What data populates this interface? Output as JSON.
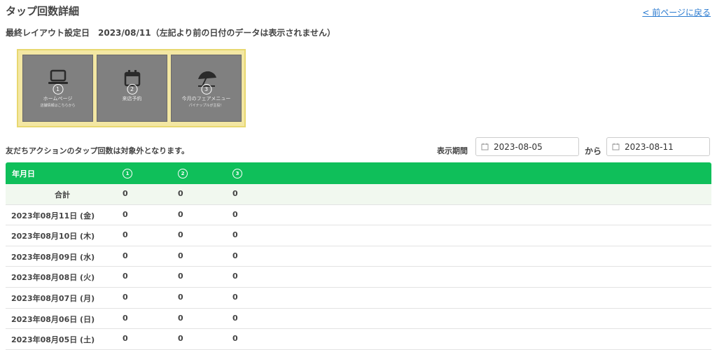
{
  "header": {
    "title": "タップ回数詳細",
    "back_link": "< 前ページに戻る",
    "layout_date": "最終レイアウト設定日　2023/08/11（左記より前の日付のデータは表示されません）"
  },
  "rich_menu": {
    "tiles": [
      {
        "number": "1",
        "label": "ホームページ",
        "sub": "店舗情報はこちらから",
        "icon": "laptop-icon"
      },
      {
        "number": "2",
        "label": "来店予約",
        "sub": "",
        "icon": "calendar-icon"
      },
      {
        "number": "3",
        "label": "今月のフェアメニュー",
        "sub": "パイナップルが主役！",
        "icon": "beach-umbrella-icon"
      }
    ]
  },
  "filter": {
    "note": "友だちアクションのタップ回数は対象外となります。",
    "period_label": "表示期間",
    "from": "2023-08-05",
    "separator": "から",
    "to": "2023-08-11"
  },
  "table": {
    "header": {
      "date": "年月日",
      "cols": [
        "1",
        "2",
        "3"
      ]
    },
    "total": {
      "label": "合計",
      "values": [
        "0",
        "0",
        "0"
      ]
    },
    "rows": [
      {
        "date": "2023年08月11日 (金)",
        "values": [
          "0",
          "0",
          "0"
        ]
      },
      {
        "date": "2023年08月10日 (木)",
        "values": [
          "0",
          "0",
          "0"
        ]
      },
      {
        "date": "2023年08月09日 (水)",
        "values": [
          "0",
          "0",
          "0"
        ]
      },
      {
        "date": "2023年08月08日 (火)",
        "values": [
          "0",
          "0",
          "0"
        ]
      },
      {
        "date": "2023年08月07日 (月)",
        "values": [
          "0",
          "0",
          "0"
        ]
      },
      {
        "date": "2023年08月06日 (日)",
        "values": [
          "0",
          "0",
          "0"
        ]
      },
      {
        "date": "2023年08月05日 (土)",
        "values": [
          "0",
          "0",
          "0"
        ]
      }
    ]
  },
  "colors": {
    "accent": "#0fbf5a",
    "link": "#2b7bd0",
    "menu_frame": "#f3e7a3"
  }
}
